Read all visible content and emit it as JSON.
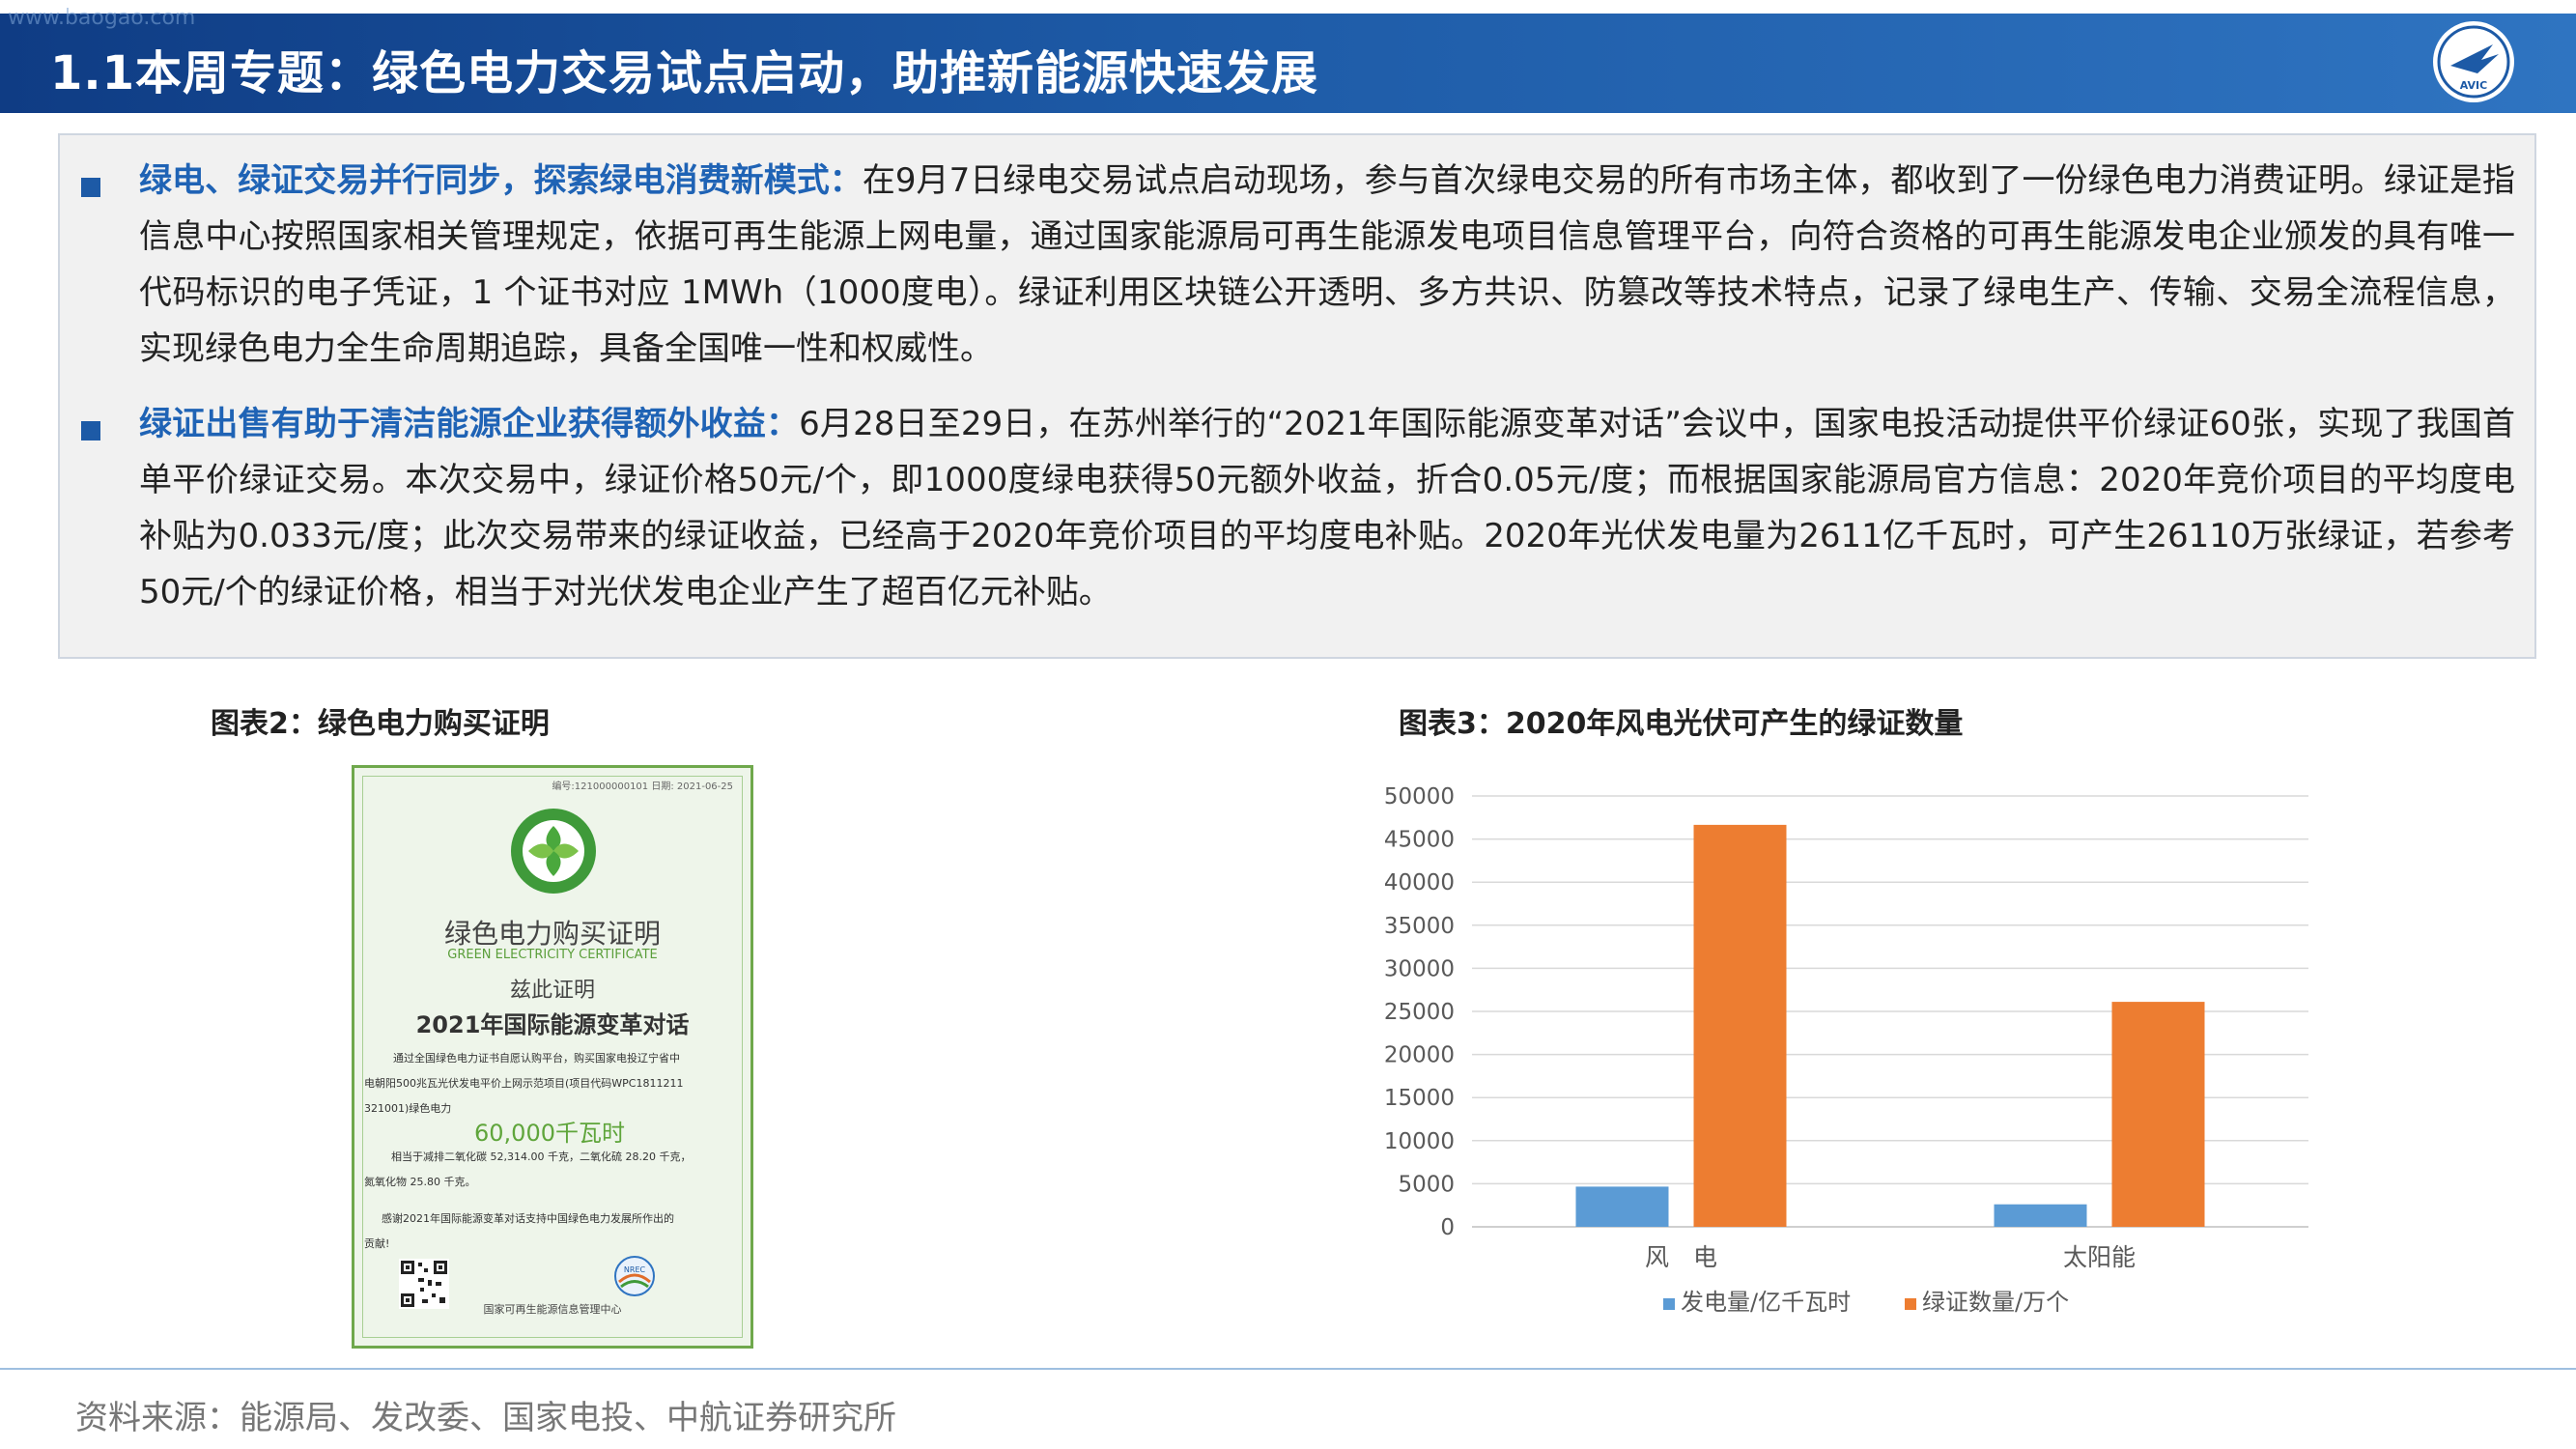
{
  "header": {
    "title": "1.1本周专题：绿色电力交易试点启动，助推新能源快速发展",
    "watermark": "www.baogao.com",
    "logo_label": "AVIC"
  },
  "bullets": [
    {
      "highlight": "绿电、绿证交易并行同步，探索绿电消费新模式：",
      "text": "在9月7日绿电交易试点启动现场，参与首次绿电交易的所有市场主体，都收到了一份绿色电力消费证明。绿证是指信息中心按照国家相关管理规定，依据可再生能源上网电量，通过国家能源局可再生能源发电项目信息管理平台，向符合资格的可再生能源发电企业颁发的具有唯一代码标识的电子凭证，1 个证书对应 1MWh（1000度电）。绿证利用区块链公开透明、多方共识、防篡改等技术特点，记录了绿电生产、传输、交易全流程信息，实现绿色电力全生命周期追踪，具备全国唯一性和权威性。"
    },
    {
      "highlight": "绿证出售有助于清洁能源企业获得额外收益：",
      "text": "6月28日至29日，在苏州举行的“2021年国际能源变革对话”会议中，国家电投活动提供平价绿证60张，实现了我国首单平价绿证交易。本次交易中，绿证价格50元/个，即1000度绿电获得50元额外收益，折合0.05元/度；而根据国家能源局官方信息：2020年竞价项目的平均度电补贴为0.033元/度；此次交易带来的绿证收益，已经高于2020年竞价项目的平均度电补贴。2020年光伏发电量为2611亿千瓦时，可产生26110万张绿证，若参考50元/个的绿证价格，相当于对光伏发电企业产生了超百亿元补贴。"
    }
  ],
  "figure2": {
    "title": "图表2：绿色电力购买证明",
    "certificate": {
      "serial": "编号:121000000101 日期: 2021-06-25",
      "title_cn": "绿色电力购买证明",
      "title_en": "GREEN ELECTRICITY CERTIFICATE",
      "certify": "兹此证明",
      "event": "2021年国际能源变革对话",
      "body_lines": [
        "通过全国绿色电力证书自愿认购平台，购买国家电投辽宁省中",
        "电朝阳500兆瓦光伏发电平价上网示范项目(项目代码WPC1811211",
        "321001)绿色电力"
      ],
      "amount": "60,000千瓦时",
      "reduction_line1": "相当于减排二氧化碳 52,314.00 千克，二氧化硫 28.20 千克，",
      "reduction_line2": "氮氧化物 25.80 千克。",
      "thanks_line1": "感谢2021年国际能源变革对话支持中国绿色电力发展所作出的",
      "thanks_line2": "贡献!",
      "issuer": "国家可再生能源信息管理中心",
      "seal_label": "NREC"
    }
  },
  "figure3": {
    "title": "图表3：2020年风电光伏可产生的绿证数量"
  },
  "chart_data": {
    "type": "bar",
    "title": "",
    "categories": [
      "风　电",
      "太阳能"
    ],
    "series": [
      {
        "name": "发电量/亿千瓦时",
        "values": [
          4665,
          2611
        ],
        "color": "#5b9bd5"
      },
      {
        "name": "绿证数量/万个",
        "values": [
          46650,
          26110
        ],
        "color": "#ed7d31"
      }
    ],
    "y_ticks": [
      "50000",
      "45000",
      "40000",
      "35000",
      "30000",
      "25000",
      "20000",
      "15000",
      "10000",
      "5000",
      "0"
    ],
    "ylim": [
      0,
      50000
    ],
    "grid": true,
    "legend": "bottom"
  },
  "footer": {
    "source": "资料来源：能源局、发改委、国家电投、中航证券研究所"
  }
}
